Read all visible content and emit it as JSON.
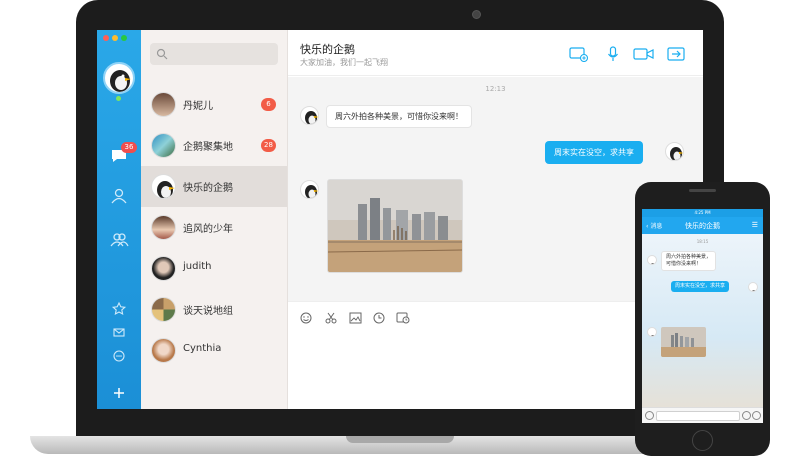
{
  "chat_list": {
    "contacts": [
      {
        "name": "丹妮儿",
        "badge": "6",
        "avatar": "girl-avatar"
      },
      {
        "name": "企鹅聚集地",
        "badge": "28",
        "avatar": "landscape-avatar"
      },
      {
        "name": "快乐的企鹅",
        "badge": "",
        "avatar": "penguin-avatar"
      },
      {
        "name": "追风的少年",
        "badge": "",
        "avatar": "boy-avatar"
      },
      {
        "name": "judith",
        "badge": "",
        "avatar": "woman-avatar"
      },
      {
        "name": "谈天说地组",
        "badge": "",
        "avatar": "group-avatar"
      },
      {
        "name": "Cynthia",
        "badge": "",
        "avatar": "woman-avatar"
      }
    ]
  },
  "rail": {
    "unread_badge": "36",
    "icons": [
      "chat-icon",
      "contacts-icon",
      "group-icon",
      "star-icon",
      "mail-icon",
      "more-icon",
      "add-icon"
    ]
  },
  "chat": {
    "title": "快乐的企鹅",
    "subtitle": "大家加油，我们一起飞翔",
    "timestamp": "12:13",
    "messages": {
      "incoming_text": "周六外拍各种美景，可惜你没来啊！",
      "outgoing_text": "周末实在没空，求共享"
    },
    "header_icons": [
      "screen-share-icon",
      "microphone-icon",
      "video-icon",
      "transfer-icon"
    ],
    "toolbar_icons": [
      "emoji-icon",
      "scissors-icon",
      "image-icon",
      "clock-icon",
      "history-icon"
    ]
  },
  "phone": {
    "status_time": "4:25 PM",
    "back_label": "消息",
    "title": "快乐的企鹅",
    "timestamp": "18:15",
    "incoming_text_line1": "周六外拍各种美景，",
    "incoming_text_line2": "可惜你没来啊！",
    "outgoing_text": "周末实在没空，求共享"
  },
  "colors": {
    "accent": "#1aaef0",
    "rail": "#1b8fd6",
    "badge": "#f25c47"
  }
}
